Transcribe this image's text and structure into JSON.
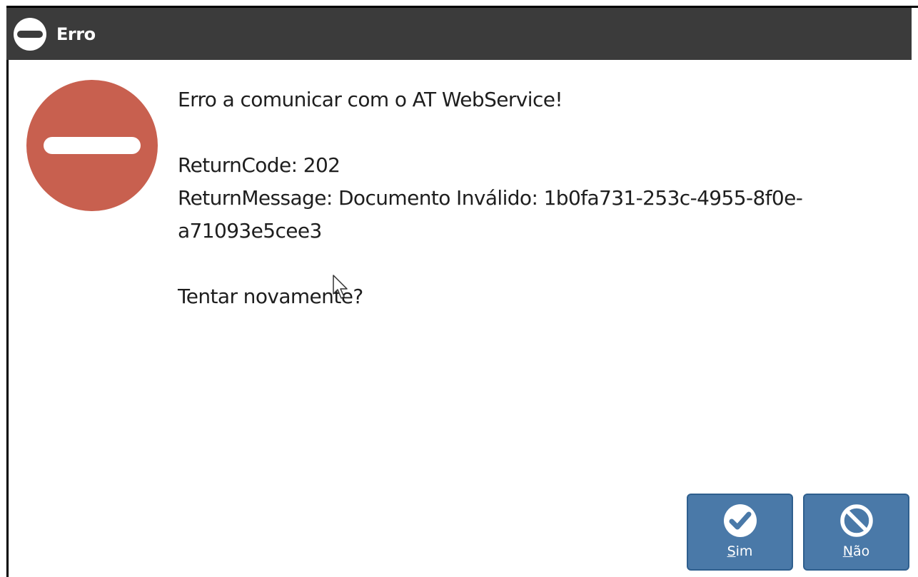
{
  "dialog": {
    "title": "Erro",
    "lines": {
      "line1": "Erro a comunicar com o AT WebService!",
      "line2": "ReturnCode: 202",
      "line3": "ReturnMessage: Documento Inválido: 1b0fa731-253c-4955-8f0e-",
      "line4": "a71093e5cee3",
      "line5": "Tentar novamente?"
    }
  },
  "buttons": {
    "sim": {
      "accel": "S",
      "rest": "im",
      "icon": "check-circle-icon"
    },
    "nao": {
      "accel": "N",
      "rest": "ão",
      "icon": "prohibited-icon"
    }
  },
  "icons": {
    "title": "error-minus-icon",
    "main": "error-stop-icon"
  },
  "colors": {
    "titlebar": "#3b3b3b",
    "error_red": "#c8604f",
    "button_blue": "#4a79a8",
    "text": "#1e1e1e"
  }
}
